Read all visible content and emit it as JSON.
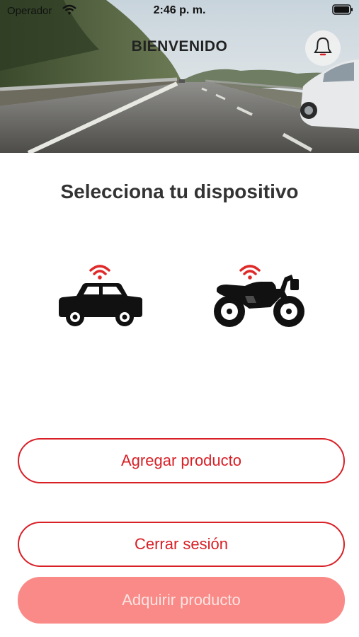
{
  "status_bar": {
    "carrier": "Operador",
    "time": "2:46 p. m."
  },
  "header": {
    "title": "BIENVENIDO",
    "notification_icon": "bell-icon"
  },
  "main": {
    "title": "Selecciona tu dispositivo",
    "devices": [
      {
        "type": "car",
        "icon": "car-signal-icon"
      },
      {
        "type": "motorcycle",
        "icon": "motorcycle-signal-icon"
      }
    ]
  },
  "actions": {
    "add_product": "Agregar producto",
    "logout": "Cerrar sesión",
    "buy_product": "Adquirir producto"
  },
  "colors": {
    "accent": "#d81f26",
    "disabled_button": "#f98a87",
    "signal": "#e02a2a"
  }
}
